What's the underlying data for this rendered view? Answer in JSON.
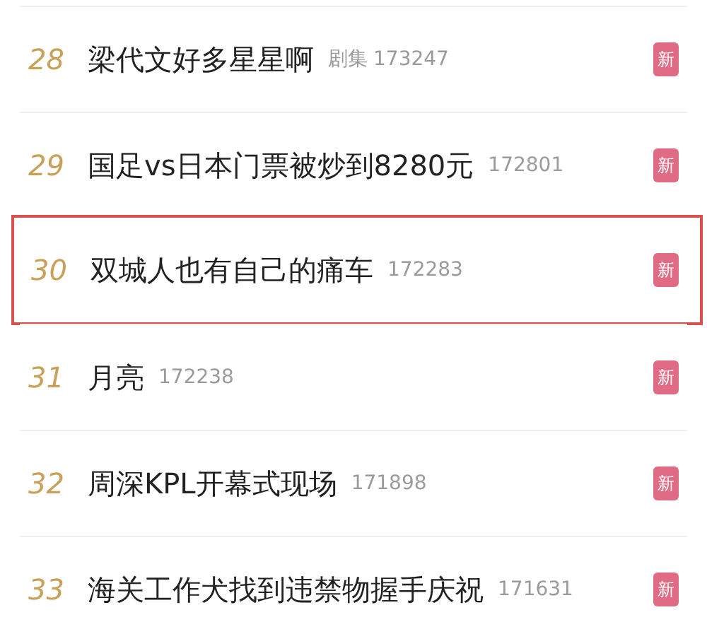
{
  "hot_list": [
    {
      "rank": "28",
      "title": "梁代文好多星星啊",
      "tag": "剧集",
      "count": "173247",
      "badge": "新",
      "selected": false
    },
    {
      "rank": "29",
      "title": "国足vs日本门票被炒到8280元",
      "count": "172801",
      "badge": "新",
      "selected": false
    },
    {
      "rank": "30",
      "title": "双城人也有自己的痛车",
      "count": "172283",
      "badge": "新",
      "selected": true
    },
    {
      "rank": "31",
      "title": "月亮",
      "count": "172238",
      "badge": "新",
      "selected": false
    },
    {
      "rank": "32",
      "title": "周深KPL开幕式现场",
      "count": "171898",
      "badge": "新",
      "selected": false
    },
    {
      "rank": "33",
      "title": "海关工作犬找到违禁物握手庆祝",
      "count": "171631",
      "badge": "新",
      "selected": false
    }
  ]
}
